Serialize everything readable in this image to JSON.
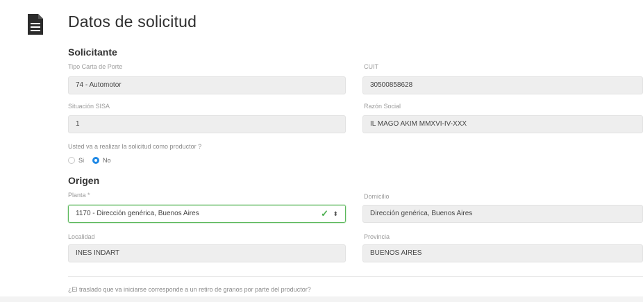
{
  "header": {
    "title": "Datos de solicitud",
    "icon": "document-icon"
  },
  "solicitante": {
    "title": "Solicitante",
    "tipo_carta": {
      "label": "Tipo Carta de Porte",
      "value": "74 - Automotor"
    },
    "cuit": {
      "label": "CUIT",
      "value": "30500858628"
    },
    "situacion_sisa": {
      "label": "Situación SISA",
      "value": "1"
    },
    "razon_social": {
      "label": "Razón Social",
      "value": "IL MAGO AKIM MMXVI-IV-XXX"
    },
    "productor_question": "Usted va a realizar la solicitud como productor ?",
    "options": {
      "si": "Si",
      "no": "No",
      "selected": "No"
    }
  },
  "origen": {
    "title": "Origen",
    "planta": {
      "label": "Planta *",
      "value": "1170 - Dirección genérica, Buenos Aires"
    },
    "domicilio": {
      "label": "Domicilio",
      "value": "Dirección genérica, Buenos Aires"
    },
    "localidad": {
      "label": "Localidad",
      "value": "INES INDART"
    },
    "provincia": {
      "label": "Provincia",
      "value": "BUENOS AIRES"
    },
    "traslado_question": "¿El traslado que va iniciarse corresponde a un retiro de granos por parte del productor?"
  },
  "colors": {
    "accent": "#1e88e5",
    "valid": "#5cb85c",
    "field_bg": "#eeeeee"
  }
}
